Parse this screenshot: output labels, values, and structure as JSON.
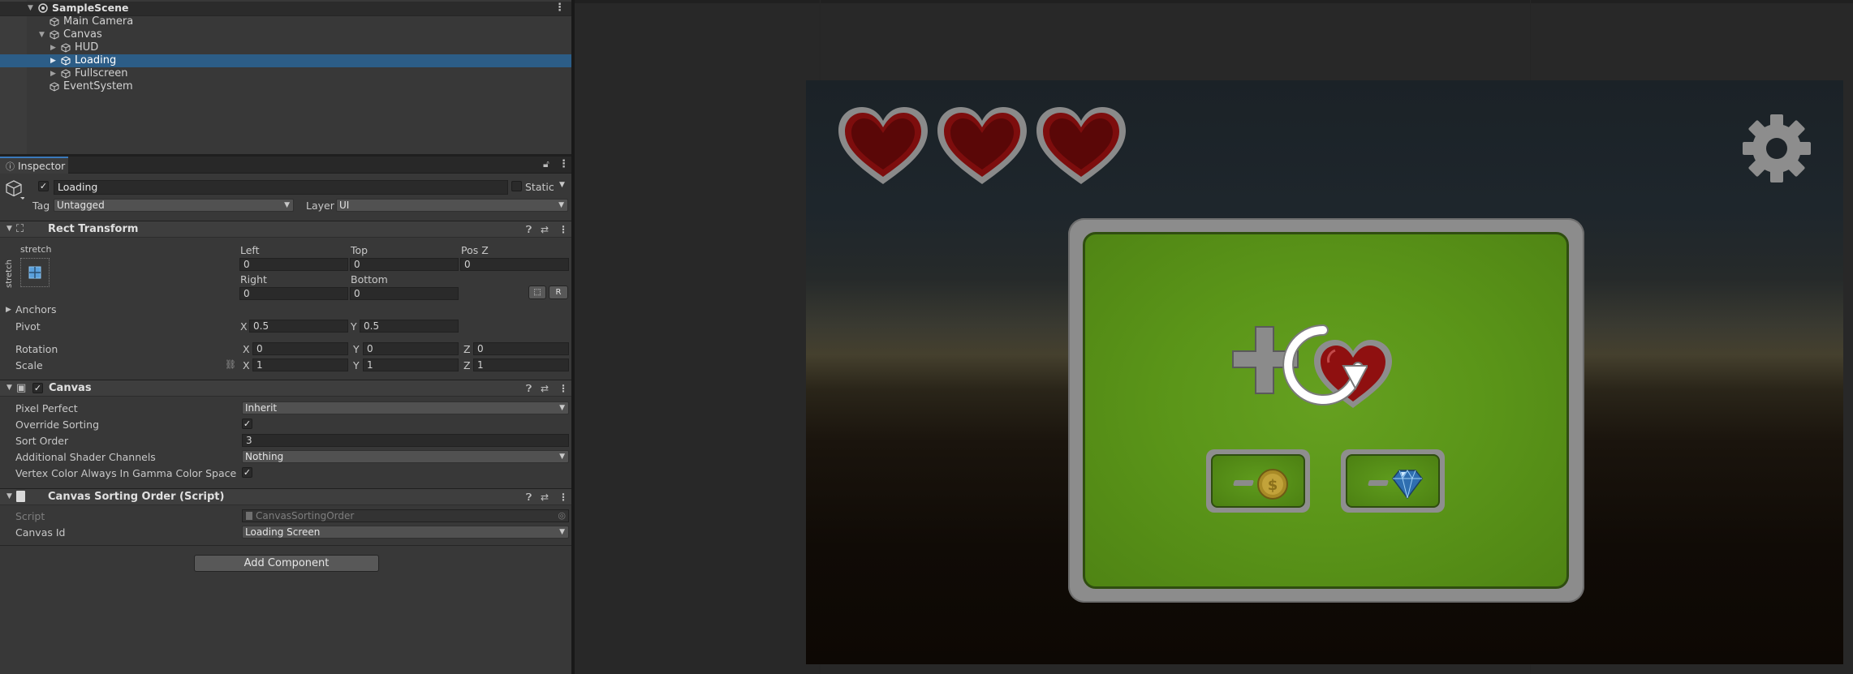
{
  "hierarchy": {
    "scene": "SampleScene",
    "items": [
      {
        "label": "Main Camera"
      },
      {
        "label": "Canvas"
      },
      {
        "label": "HUD"
      },
      {
        "label": "Loading"
      },
      {
        "label": "Fullscreen"
      },
      {
        "label": "EventSystem"
      }
    ]
  },
  "inspector": {
    "tab_label": "Inspector",
    "object": {
      "name": "Loading",
      "static_label": "Static",
      "tag_label": "Tag",
      "tag_value": "Untagged",
      "layer_label": "Layer",
      "layer_value": "UI"
    },
    "rect_transform": {
      "title": "Rect Transform",
      "anchor_preset": "stretch",
      "left_label": "Left",
      "left": "0",
      "top_label": "Top",
      "top": "0",
      "posz_label": "Pos Z",
      "posz": "0",
      "right_label": "Right",
      "right": "0",
      "bottom_label": "Bottom",
      "bottom": "0",
      "r_button": "R",
      "anchors_label": "Anchors",
      "pivot_label": "Pivot",
      "pivot_x": "0.5",
      "pivot_y": "0.5",
      "rotation_label": "Rotation",
      "rot_x": "0",
      "rot_y": "0",
      "rot_z": "0",
      "scale_label": "Scale",
      "scale_x": "1",
      "scale_y": "1",
      "scale_z": "1",
      "axis_x": "X",
      "axis_y": "Y",
      "axis_z": "Z"
    },
    "canvas": {
      "title": "Canvas",
      "pixel_perfect_label": "Pixel Perfect",
      "pixel_perfect": "Inherit",
      "override_sorting_label": "Override Sorting",
      "override_sorting": true,
      "sort_order_label": "Sort Order",
      "sort_order": "3",
      "shader_channels_label": "Additional Shader Channels",
      "shader_channels": "Nothing",
      "vertex_color_label": "Vertex Color Always In Gamma Color Space",
      "vertex_color": true
    },
    "sorting_script": {
      "title": "Canvas Sorting Order (Script)",
      "script_label": "Script",
      "script_value": "CanvasSortingOrder",
      "canvas_id_label": "Canvas Id",
      "canvas_id": "Loading Screen"
    },
    "add_component": "Add Component"
  },
  "colors": {
    "selection": "#2c5d87",
    "panel_green": "#5b9619",
    "heart_red": "#7d0d0d"
  },
  "game": {
    "lives": 3
  }
}
